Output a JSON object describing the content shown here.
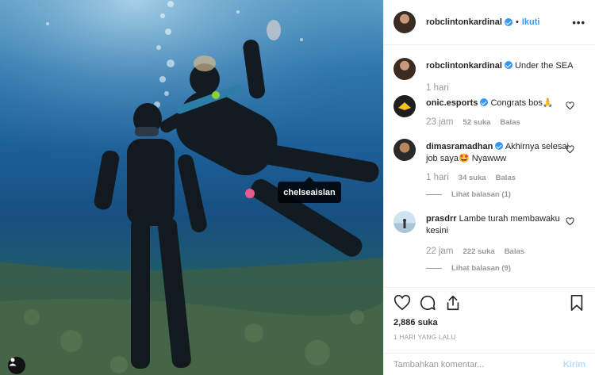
{
  "photo": {
    "tag_label": "chelseaislan"
  },
  "header": {
    "username": "robclintonkardinal",
    "separator": "•",
    "follow_label": "Ikuti",
    "more_label": "•••"
  },
  "caption": {
    "username": "robclintonkardinal",
    "text": "Under the SEA",
    "time": "1 hari"
  },
  "comments": [
    {
      "username": "onic.esports",
      "verified": true,
      "text": "Congrats bos🙏",
      "time": "23 jam",
      "likes": "52 suka",
      "reply_label": "Balas",
      "view_replies": ""
    },
    {
      "username": "dimasramadhan",
      "verified": true,
      "text": "Akhirnya selesai job saya🤩 Nyawww",
      "time": "1 hari",
      "likes": "34 suka",
      "reply_label": "Balas",
      "view_replies": "Lihat balasan (1)"
    },
    {
      "username": "prasdrr",
      "verified": false,
      "text": "Lambe turah membawaku kesini",
      "time": "22 jam",
      "likes": "222 suka",
      "reply_label": "Balas",
      "view_replies": "Lihat balasan (9)"
    }
  ],
  "actions": {
    "likes_count": "2,886 suka",
    "posted_ago": "1 HARI YANG LALU"
  },
  "comment_box": {
    "placeholder": "Tambahkan komentar...",
    "post_label": "Kirim"
  },
  "colors": {
    "accent": "#3897f0",
    "post_disabled": "#b2dffc",
    "muted": "#999999"
  }
}
